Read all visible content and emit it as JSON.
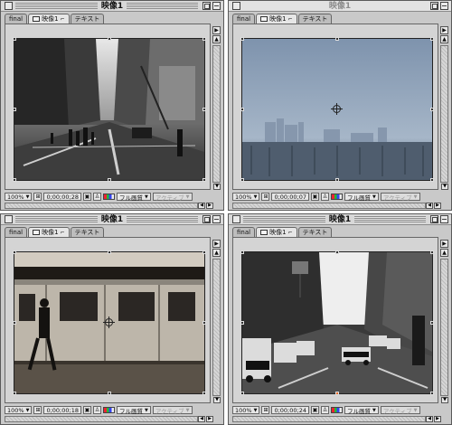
{
  "windows": [
    {
      "title": "映像1",
      "active": true,
      "tabs": [
        "final",
        "映像1",
        "テキスト"
      ],
      "zoom": "100%",
      "timecode": "0;00;00;28",
      "quality": "フル画質",
      "mode": "アクティブ",
      "scene": "city-street"
    },
    {
      "title": "映像1",
      "active": false,
      "tabs": [
        "final",
        "映像1",
        "テキスト"
      ],
      "zoom": "100%",
      "timecode": "0;00;00;07",
      "quality": "フル画質",
      "mode": "アクティブ",
      "scene": "foggy-skyline"
    },
    {
      "title": "映像1",
      "active": true,
      "tabs": [
        "final",
        "映像1",
        "テキスト"
      ],
      "zoom": "100%",
      "timecode": "0;00;00;18",
      "quality": "フル画質",
      "mode": "アクティブ",
      "scene": "subway-train"
    },
    {
      "title": "映像1",
      "active": true,
      "tabs": [
        "final",
        "映像1",
        "テキスト"
      ],
      "zoom": "100%",
      "timecode": "0;00;00;24",
      "quality": "フル画質",
      "mode": "アクティブ",
      "scene": "traffic-street"
    }
  ],
  "icons": {
    "close": "close-box-icon",
    "zoom": "zoom-box-icon",
    "collapse": "collapse-box-icon",
    "tab": "composition-icon",
    "lock": "lock-icon",
    "region": "region-of-interest-icon",
    "snapshot": "snapshot-icon",
    "channel": "rgb-channel-icon"
  }
}
